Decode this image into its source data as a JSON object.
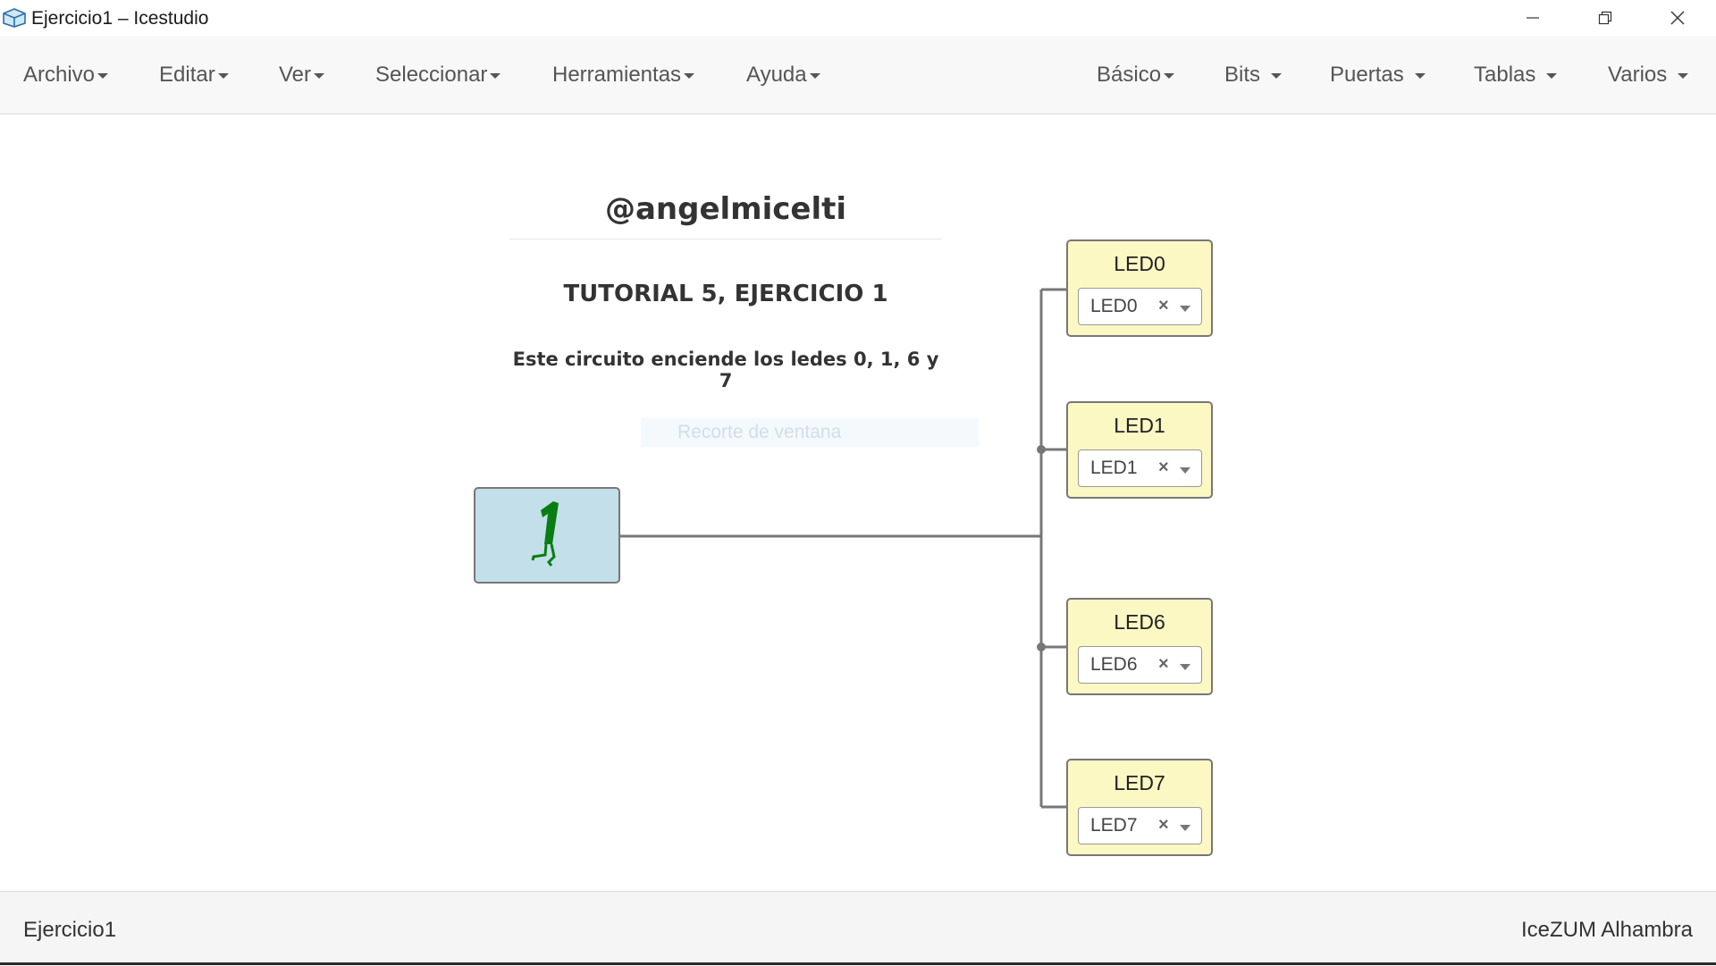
{
  "window": {
    "title": "Ejercicio1 – Icestudio"
  },
  "menu": {
    "left": [
      "Archivo",
      "Editar",
      "Ver",
      "Seleccionar",
      "Herramientas",
      "Ayuda"
    ],
    "right": [
      "Básico",
      "Bits",
      "Puertas",
      "Tablas",
      "Varios"
    ]
  },
  "canvas": {
    "info": {
      "author": "@angelmicelti",
      "tutorial": "TUTORIAL 5, EJERCICIO 1",
      "description": "Este circuito enciende los ledes 0, 1, 6 y 7"
    },
    "overlay_text": "Recorte de ventana",
    "constant_block": {
      "value": "1",
      "icon": "walking-one-icon",
      "color": "#c3dfe9"
    },
    "led_blocks": [
      {
        "title": "LED0",
        "selected": "LED0"
      },
      {
        "title": "LED1",
        "selected": "LED1"
      },
      {
        "title": "LED6",
        "selected": "LED6"
      },
      {
        "title": "LED7",
        "selected": "LED7"
      }
    ],
    "led_block_color": "#fbf8c4",
    "clear_symbol": "×"
  },
  "status": {
    "project": "Ejercicio1",
    "board": "IceZUM Alhambra"
  }
}
